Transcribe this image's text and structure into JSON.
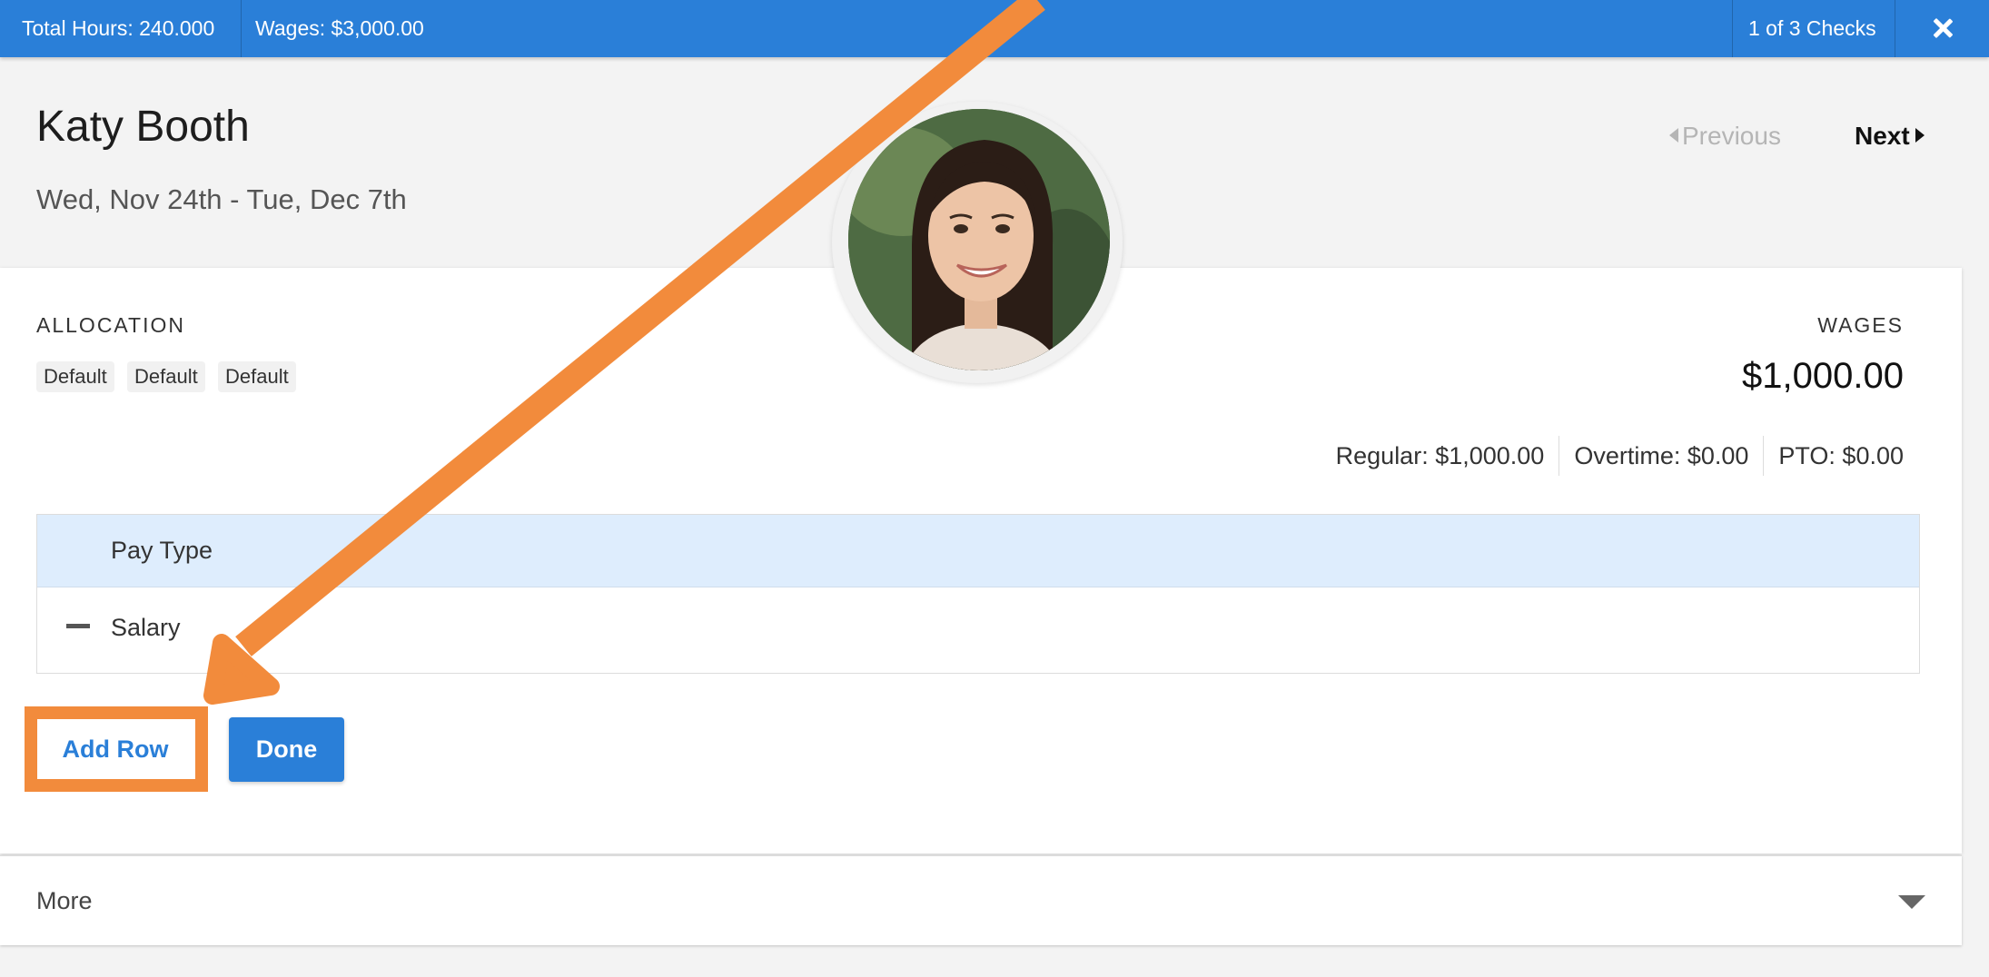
{
  "topbar": {
    "total_hours": "Total Hours: 240.000",
    "wages": "Wages: $3,000.00",
    "check_counter": "1 of 3 Checks"
  },
  "employee": {
    "name": "Katy Booth",
    "date_range": "Wed, Nov 24th - Tue, Dec 7th"
  },
  "pager": {
    "previous_label": "Previous",
    "next_label": "Next"
  },
  "allocation": {
    "label": "ALLOCATION",
    "chips": [
      "Default",
      "Default",
      "Default"
    ]
  },
  "wages_summary": {
    "label": "WAGES",
    "amount": "$1,000.00",
    "regular": "Regular: $1,000.00",
    "overtime": "Overtime: $0.00",
    "pto": "PTO: $0.00"
  },
  "pay_table": {
    "header": "Pay Type",
    "rows": [
      {
        "label": "Salary"
      }
    ]
  },
  "actions": {
    "add_row_label": "Add Row",
    "done_label": "Done"
  },
  "more": {
    "label": "More"
  },
  "colors": {
    "accent": "#2a7fd8",
    "annotation": "#f28b3c"
  }
}
